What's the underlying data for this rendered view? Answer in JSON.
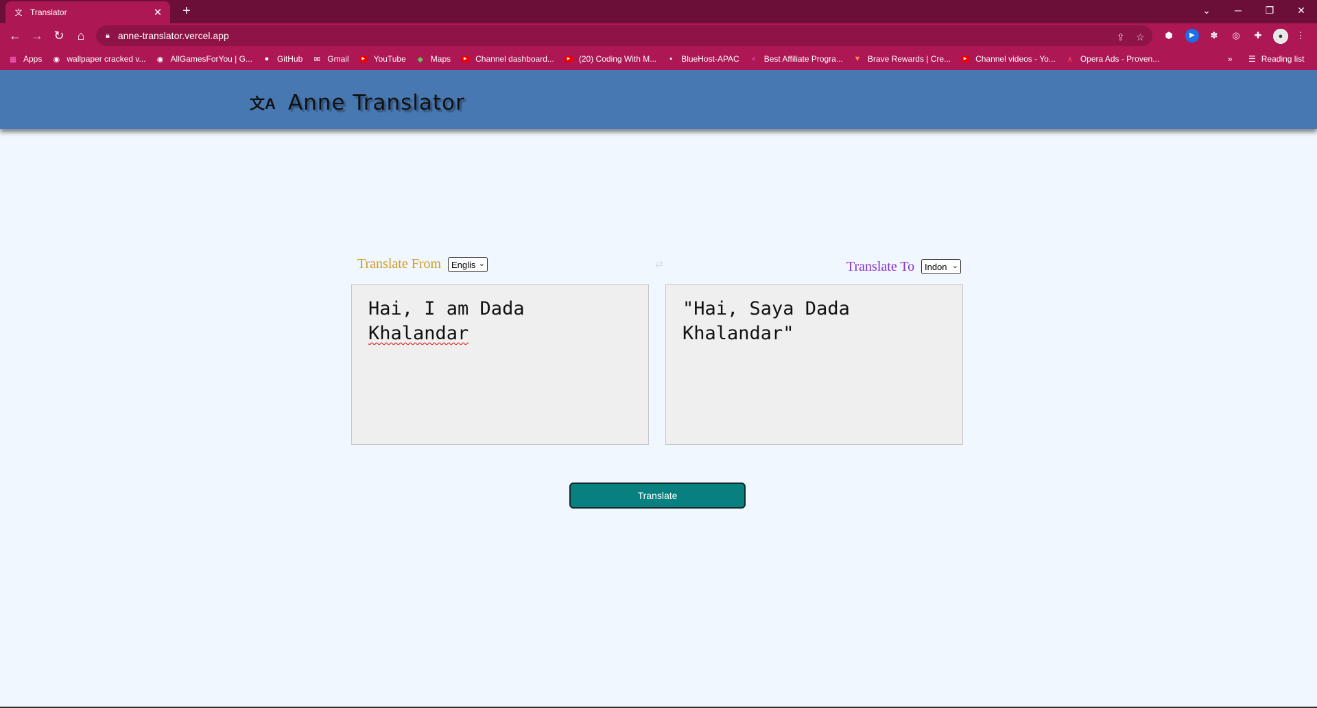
{
  "browser": {
    "tab": {
      "title": "Translator",
      "close_glyph": "✕"
    },
    "new_tab_glyph": "+",
    "window_controls": {
      "tablist": "⌄",
      "minimize": "─",
      "restore": "❐",
      "close": "✕"
    },
    "nav": {
      "back": "←",
      "forward": "→",
      "reload": "↻",
      "home": "⌂"
    },
    "url": "anne-translator.vercel.app",
    "bookmarks": [
      {
        "label": "Apps",
        "icon": "apps-grid-icon"
      },
      {
        "label": "wallpaper cracked v...",
        "icon": "globe-icon"
      },
      {
        "label": "AllGamesForYou | G...",
        "icon": "globe-icon"
      },
      {
        "label": "GitHub",
        "icon": "github-icon"
      },
      {
        "label": "Gmail",
        "icon": "gmail-icon"
      },
      {
        "label": "YouTube",
        "icon": "youtube-icon"
      },
      {
        "label": "Maps",
        "icon": "maps-icon"
      },
      {
        "label": "Channel dashboard...",
        "icon": "youtube-icon"
      },
      {
        "label": "(20) Coding With M...",
        "icon": "youtube-icon"
      },
      {
        "label": "BlueHost-APAC",
        "icon": "bluehost-icon"
      },
      {
        "label": "Best Affiliate Progra...",
        "icon": "affiliate-icon"
      },
      {
        "label": "Brave Rewards | Cre...",
        "icon": "brave-icon"
      },
      {
        "label": "Channel videos - Yo...",
        "icon": "youtube-icon"
      },
      {
        "label": "Opera Ads - Proven...",
        "icon": "opera-icon"
      }
    ],
    "bookmarks_overflow": "»",
    "reading_list": "Reading list"
  },
  "app": {
    "logo_icon": "文A",
    "title": "Anne Translator",
    "translate_from_label": "Translate From",
    "from_language": "Englis",
    "translate_to_label": "Translate To",
    "to_language": "Indon",
    "swap_glyph": "⇄",
    "source_text_line1": "Hai, I am Dada",
    "source_text_line2": "Khalandar",
    "translated_text": "\"Hai, Saya Dada Khalandar\"",
    "translate_button": "Translate"
  },
  "colors": {
    "tab_bar": "#6b0e38",
    "browser_accent": "#ad1754",
    "header": "#4878b2",
    "page_background": "#f0f7ff",
    "from_label": "#d39b1c",
    "to_label": "#8b2fc9",
    "button": "#088080"
  }
}
